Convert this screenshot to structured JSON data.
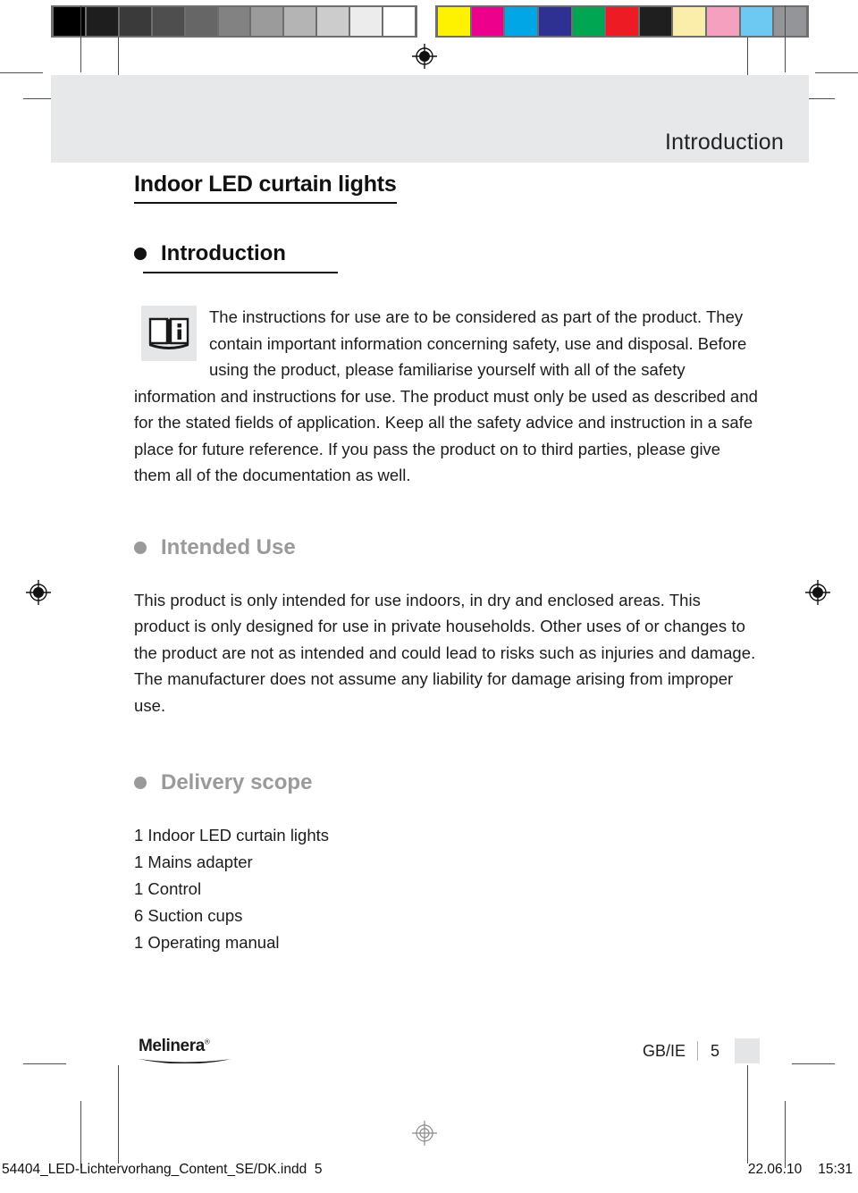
{
  "calibration": {
    "grayscale_swatches": [
      "#000000",
      "#1e1e1e",
      "#3a3a3a",
      "#4e4e4e",
      "#666666",
      "#828282",
      "#9b9b9b",
      "#b4b4b4",
      "#cccccc",
      "#ececec",
      "#ffffff"
    ],
    "color_swatches": [
      "#fff200",
      "#ec008c",
      "#00a6e6",
      "#2e3192",
      "#00a651",
      "#ed1c24",
      "#1f1f1f",
      "#faeeaa",
      "#f5a0bf",
      "#6dc8f2",
      "#939598"
    ]
  },
  "header": {
    "running_head": "Introduction"
  },
  "document": {
    "title": "Indoor LED curtain lights"
  },
  "sections": {
    "introduction": {
      "heading": "Introduction",
      "icon_name": "info-book-icon",
      "icon_letter": "i",
      "text": "The instructions for use are to be considered as part of the product. They contain important information concerning safety, use and disposal. Before using the product, please familiarise yourself with all of the safety information and instructions for use. The product must only be used as described and for the stated fields of application. Keep all the safety advice and instruction in a safe place for future reference. If you pass the product on to third parties, please give them all of the documentation as well."
    },
    "intended_use": {
      "heading": "Intended Use",
      "text": "This product is only intended for use indoors, in dry and enclosed areas. This product is only designed for use in private households. Other uses of or changes to the product are not as intended and could lead to risks such as injuries and damage. The manufacturer does not assume any liability for damage arising from improper use."
    },
    "delivery_scope": {
      "heading": "Delivery scope",
      "items": [
        "1 Indoor LED curtain lights",
        "1 Mains adapter",
        "1 Control",
        "6 Suction cups",
        "1 Operating manual"
      ]
    }
  },
  "footer": {
    "brand": "Melinera",
    "brand_registered": "®",
    "language": "GB/IE",
    "page_number": "5"
  },
  "slug": {
    "filename": "54404_LED-Lichtervorhang_Content_SE/DK.indd",
    "file_page": "5",
    "date": "22.06.10",
    "time": "15:31"
  },
  "colors": {
    "heading_black": "#111111",
    "heading_gray": "#9a9a9a",
    "header_band": "#e6e8e9",
    "icon_background": "#e4e6e7"
  }
}
